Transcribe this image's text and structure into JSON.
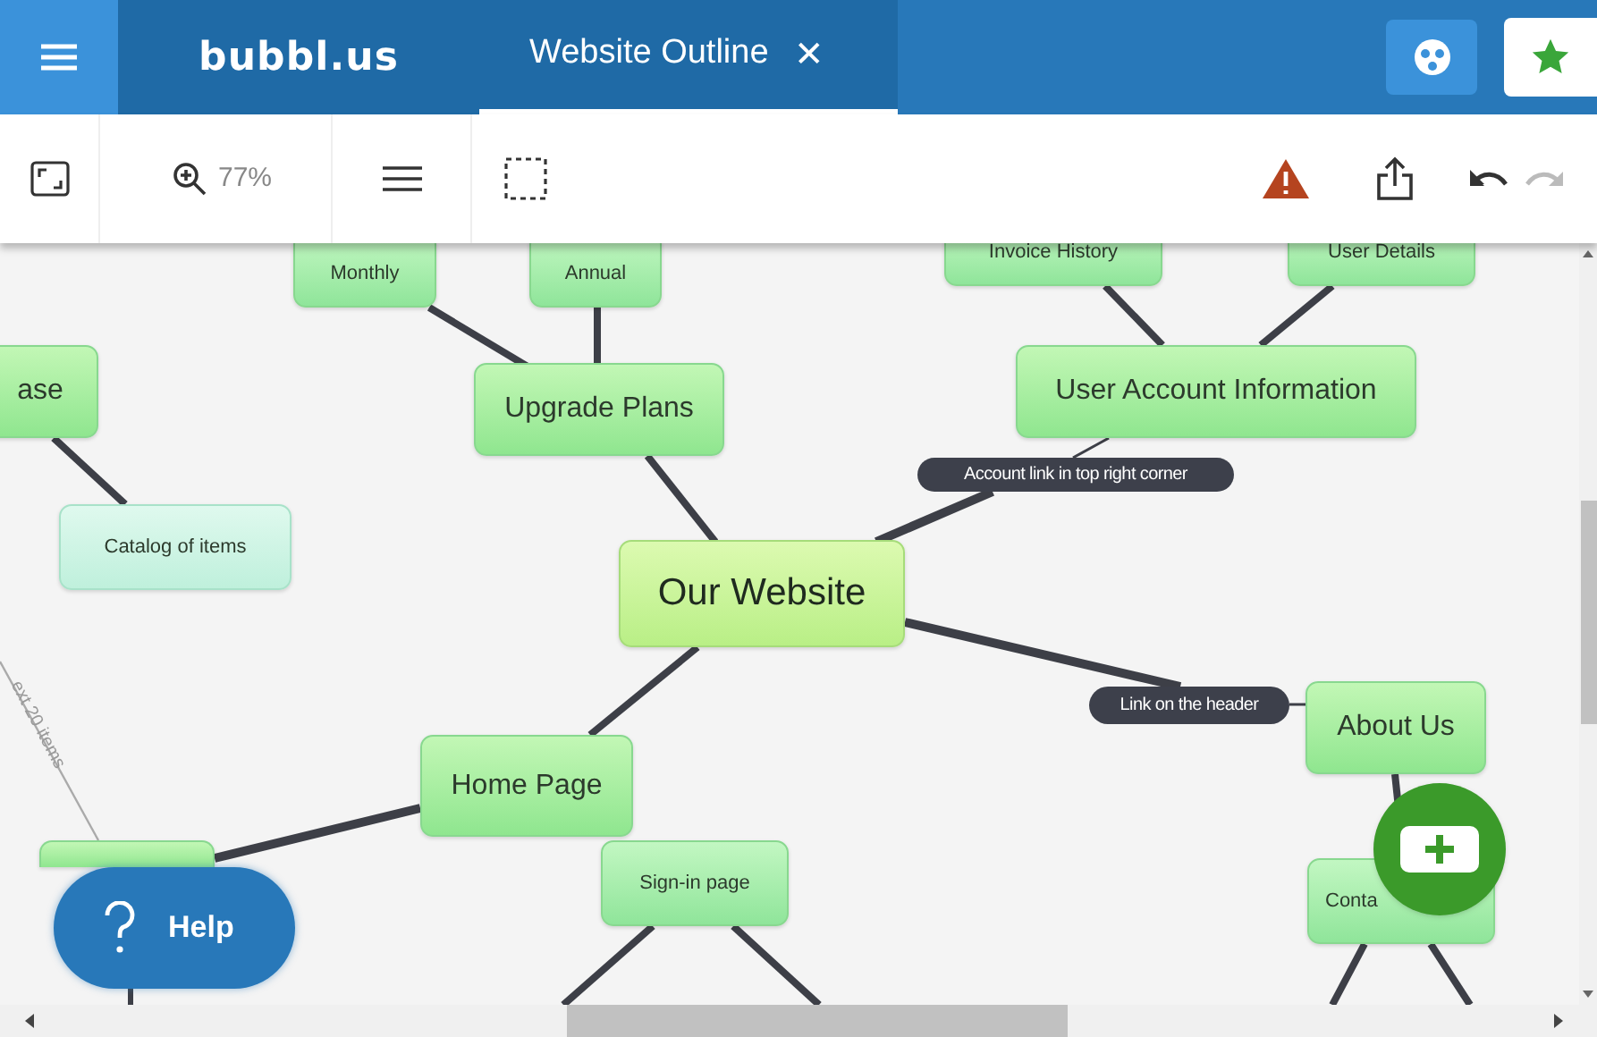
{
  "top_bar": {
    "logo": "bubbl.us",
    "tabs": [
      {
        "title": "Website Outline",
        "close": "✕",
        "selected": true
      }
    ]
  },
  "toolbar": {
    "zoom": "77%"
  },
  "mindmap": {
    "nodes": [
      {
        "text": "Monthly",
        "kind": "small"
      },
      {
        "text": "Annual",
        "kind": "small"
      },
      {
        "text": "Invoice History",
        "kind": "small"
      },
      {
        "text": "User Details",
        "kind": "small"
      },
      {
        "text": "ase",
        "kind": "main"
      },
      {
        "text": "Upgrade Plans",
        "kind": "main"
      },
      {
        "text": "User Account Information",
        "kind": "main"
      },
      {
        "text": "Catalog of items",
        "kind": "pale"
      },
      {
        "text": "Our Website",
        "kind": "root"
      },
      {
        "text": "About Us",
        "kind": "main"
      },
      {
        "text": "Home Page",
        "kind": "main"
      },
      {
        "text": "Sign-in page",
        "kind": "small"
      },
      {
        "kind": "main"
      },
      {
        "text": "Conta",
        "kind": "small"
      }
    ],
    "edge_labels": [
      "Account link in top right corner",
      "Link on the header"
    ],
    "note": "ext 20 items"
  },
  "help_button": "Help"
}
